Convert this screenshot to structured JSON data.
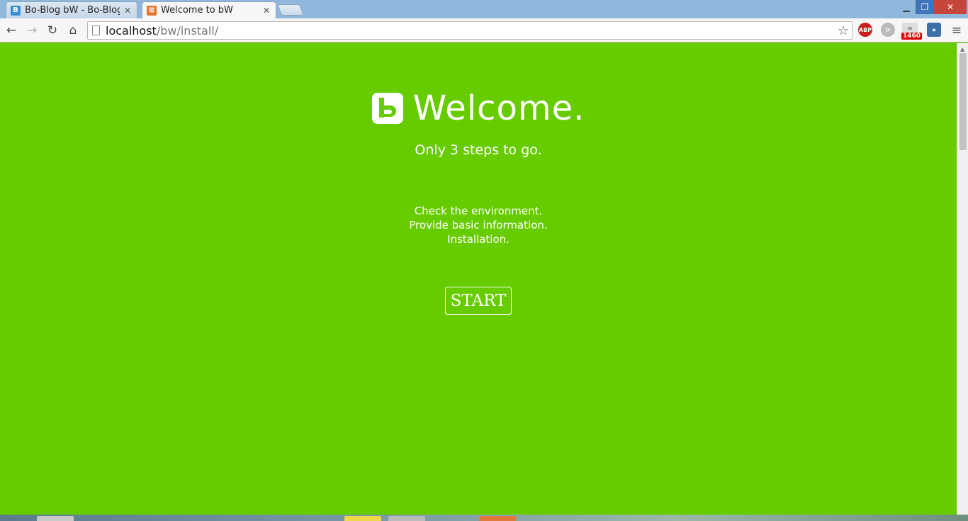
{
  "browser": {
    "tabs": [
      {
        "title": "Bo-Blog bW - Bo-Blog",
        "favicon_letter": "B",
        "favicon_color": "#3a8fd6",
        "active": false
      },
      {
        "title": "Welcome to bW",
        "favicon_letter": "⊠",
        "favicon_color": "#e8742a",
        "active": true
      }
    ],
    "address": {
      "host": "localhost",
      "path": "/bw/install/"
    },
    "extensions": {
      "abp": "ABP",
      "mail_count": "1460"
    }
  },
  "page": {
    "heading": "Welcome.",
    "subtitle": "Only 3 steps to go.",
    "steps": [
      "Check the environment.",
      "Provide basic information.",
      "Installation."
    ],
    "start_label": "START"
  },
  "colors": {
    "background": "#66cc00",
    "text": "#ffffff"
  }
}
